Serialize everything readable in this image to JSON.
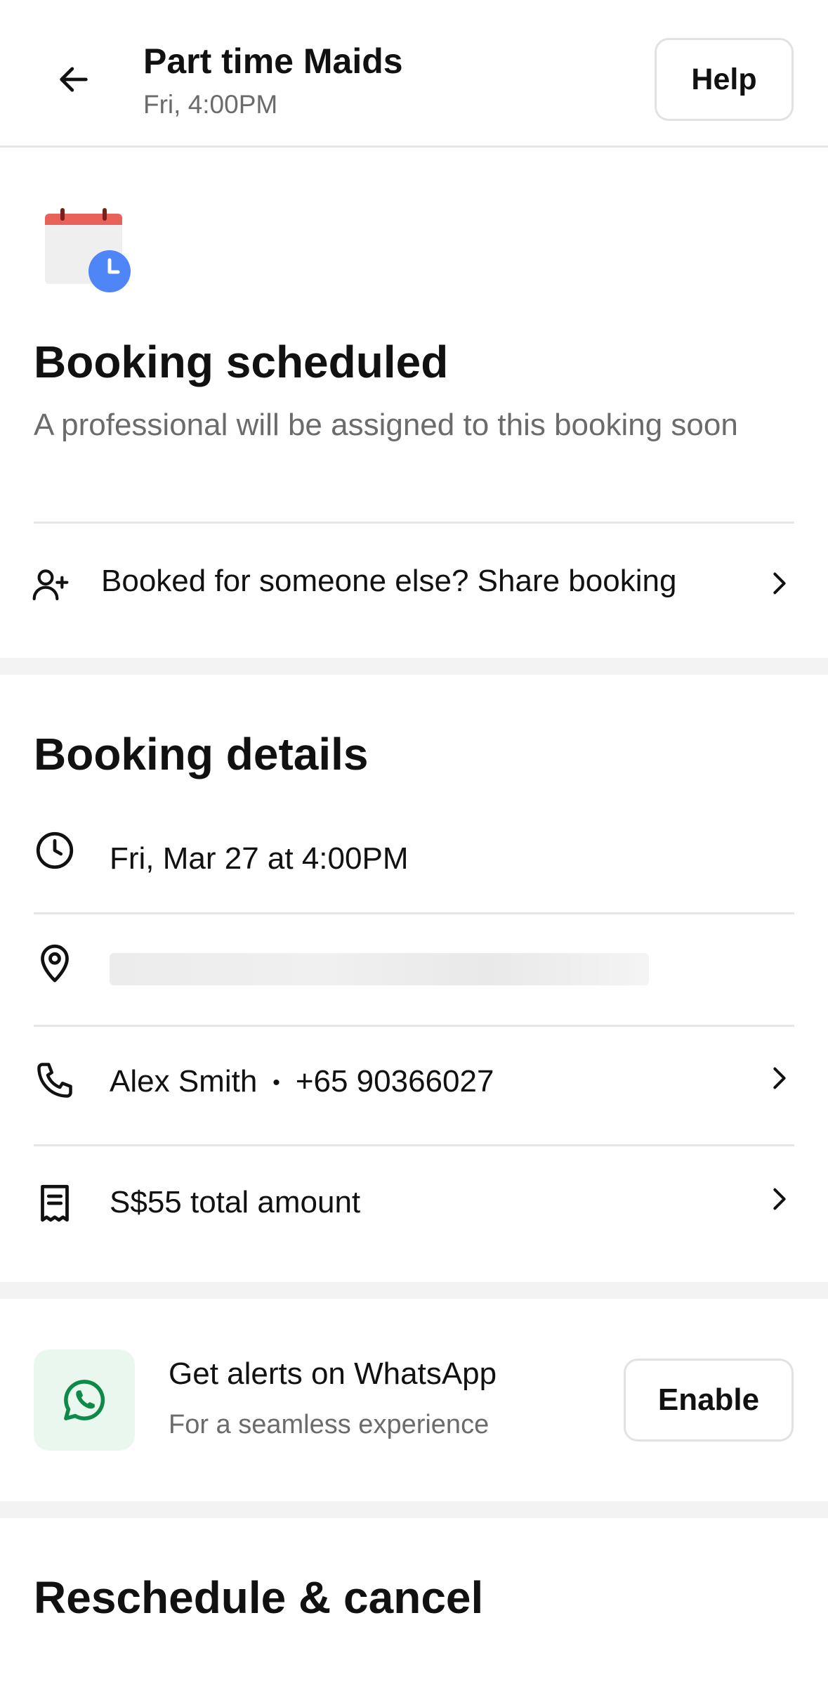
{
  "header": {
    "title": "Part time Maids",
    "subtitle": "Fri, 4:00PM",
    "help_label": "Help"
  },
  "status": {
    "title": "Booking scheduled",
    "subtitle": "A professional will be assigned to this booking soon"
  },
  "share": {
    "label": "Booked for someone else? Share booking"
  },
  "details": {
    "section_title": "Booking details",
    "datetime": "Fri, Mar 27 at 4:00PM",
    "contact_name": "Alex Smith",
    "contact_separator": "•",
    "contact_phone": "+65 90366027",
    "amount": "S$55 total amount"
  },
  "whatsapp": {
    "title": "Get alerts on WhatsApp",
    "subtitle": "For a seamless experience",
    "enable_label": "Enable"
  },
  "reschedule": {
    "section_title": "Reschedule & cancel"
  },
  "colors": {
    "calendar_red": "#e8625a",
    "clock_blue": "#4f86f7",
    "whatsapp_green": "#0d8a4a",
    "whatsapp_tile": "#e9f7ee",
    "muted_text": "#6b6b6b"
  },
  "icons": [
    "back-arrow-icon",
    "calendar-clock-icon",
    "add-person-icon",
    "chevron-right-icon",
    "clock-icon",
    "location-pin-icon",
    "phone-icon",
    "receipt-icon",
    "whatsapp-icon"
  ]
}
